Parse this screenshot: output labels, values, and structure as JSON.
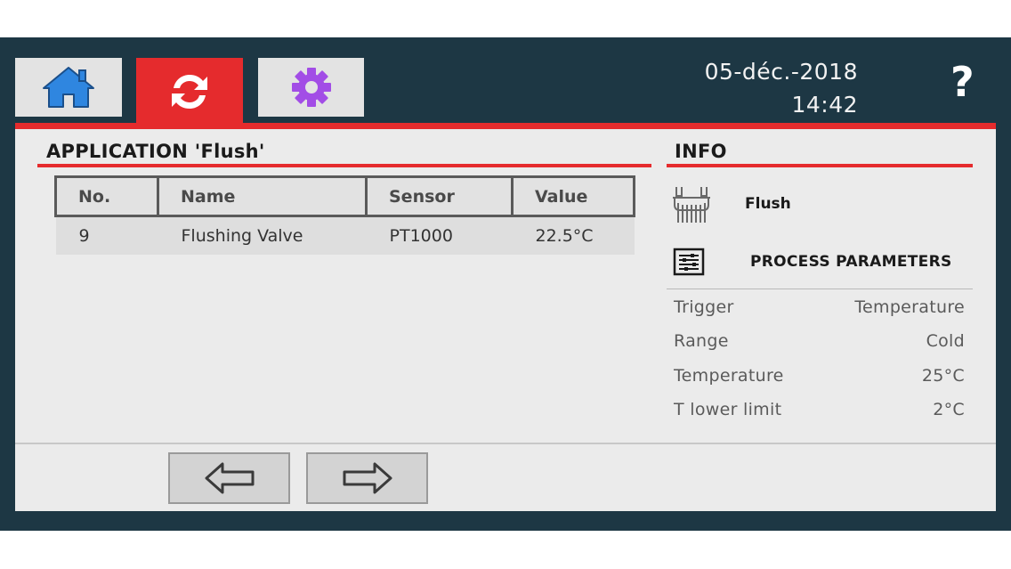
{
  "header": {
    "tabs": [
      {
        "icon": "home-icon",
        "color": "#2f86e0"
      },
      {
        "icon": "sync-icon",
        "color": "#ffffff",
        "active": true
      },
      {
        "icon": "gear-icon",
        "color": "#a24de6"
      }
    ],
    "date": "05-déc.-2018",
    "time": "14:42",
    "help_label": "?"
  },
  "main": {
    "title": "APPLICATION 'Flush'",
    "table": {
      "columns": [
        "No.",
        "Name",
        "Sensor",
        "Value"
      ],
      "rows": [
        {
          "no": "9",
          "name": "Flushing Valve",
          "sensor": "PT1000",
          "value": "22.5°C"
        }
      ]
    }
  },
  "info": {
    "title": "INFO",
    "app_name": "Flush",
    "process_title": "PROCESS PARAMETERS",
    "params": [
      {
        "label": "Trigger",
        "value": "Temperature"
      },
      {
        "label": "Range",
        "value": "Cold"
      },
      {
        "label": "Temperature",
        "value": "25°C"
      },
      {
        "label": "T lower limit",
        "value": "2°C"
      }
    ]
  },
  "footer": {
    "prev_icon": "arrow-left-icon",
    "next_icon": "arrow-right-icon"
  },
  "colors": {
    "accent": "#e52b2d",
    "frame": "#1d3744",
    "panel": "#ebebeb"
  }
}
